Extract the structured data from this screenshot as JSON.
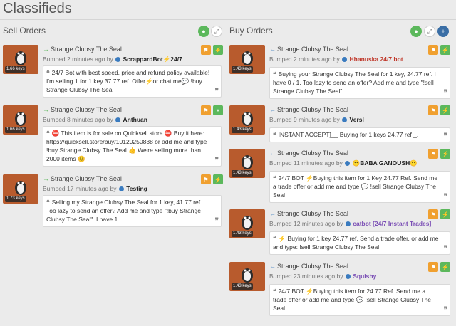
{
  "page": {
    "title": "Classifieds"
  },
  "sell": {
    "title": "Sell Orders",
    "listings": [
      {
        "keys": "1.66 keys",
        "name": "Strange Clubsy The Seal",
        "bumped": "Bumped 2 minutes ago by",
        "user": "ScrappardBot⚡24/7",
        "desc": "24/7 Bot with best speed, price and refund policy available! I'm selling 1 for 1 key 37.77 ref. Offer⚡or chat me💬 !buy Strange Clubsy The Seal",
        "icon2": "bolt-icon"
      },
      {
        "keys": "1.66 keys",
        "name": "Strange Clubsy The Seal",
        "bumped": "Bumped 8 minutes ago by",
        "user": "Anthuan",
        "desc": "⛔ This item is for sale on Quicksell.store ⛔ Buy it here: https://quicksell.store/buy/10120250838 or add me and type !buy Strange Clubsy The Seal 👍 We're selling more than 2000 items 😊",
        "icon2": "add-friend-icon"
      },
      {
        "keys": "1.73 keys",
        "name": "Strange Clubsy The Seal",
        "bumped": "Bumped 17 minutes ago by",
        "user": "Testing",
        "desc": "Selling my Strange Clubsy The Seal for 1 key, 41.77 ref. Too lazy to send an offer? Add me and type \"!buy Strange Clubsy The Seal\". I have 1.",
        "icon2": "bolt-icon"
      }
    ]
  },
  "buy": {
    "title": "Buy Orders",
    "listings": [
      {
        "keys": "1.43 keys",
        "name": "Strange Clubsy The Seal",
        "bumped": "Bumped 2 minutes ago by",
        "user": "Hhanuska 24/7 bot",
        "desc": "Buying your Strange Clubsy The Seal for 1 key, 24.77 ref. I have 0 / 1. Too lazy to send an offer? Add me and type \"!sell Strange Clubsy The Seal\".",
        "icon2": "bolt-icon"
      },
      {
        "keys": "1.43 keys",
        "name": "Strange Clubsy The Seal",
        "bumped": "Bumped 9 minutes ago by",
        "user": "Versl",
        "desc": "INSTANT ACCEPT]__ Buying for 1 keys 24.77 ref _.",
        "icon2": "bolt-icon"
      },
      {
        "keys": "1.43 keys",
        "name": "Strange Clubsy The Seal",
        "bumped": "Bumped 11 minutes ago by",
        "user": "😐BABA GANOUSH😐",
        "desc": "24/7 BOT ⚡Buying this item for 1 Key 24.77 Ref. Send me a trade offer or add me and type 💬 !sell Strange Clubsy The Seal",
        "icon2": "bolt-icon"
      },
      {
        "keys": "1.43 keys",
        "name": "Strange Clubsy The Seal",
        "bumped": "Bumped 12 minutes ago by",
        "user": "catbot [24/7 Instant Trades]",
        "desc": "⚡ Buying for 1 key 24.77 ref. Send a trade offer, or add me and type: !sell Strange Clubsy The Seal",
        "icon2": "bolt-icon"
      },
      {
        "keys": "1.43 keys",
        "name": "Strange Clubsy The Seal",
        "bumped": "Bumped 23 minutes ago by",
        "user": "Squishy",
        "desc": "24/7 BOT ⚡Buying this item for 24.77 Ref. Send me a trade offer or add me and type 💬 !sell Strange Clubsy The Seal",
        "icon2": "bolt-icon"
      }
    ]
  },
  "colors": {
    "avatar_bg": "#b85b2d",
    "accent_green": "#5cb85c",
    "accent_orange": "#f0a030",
    "accent_blue": "#3a6ea5"
  }
}
